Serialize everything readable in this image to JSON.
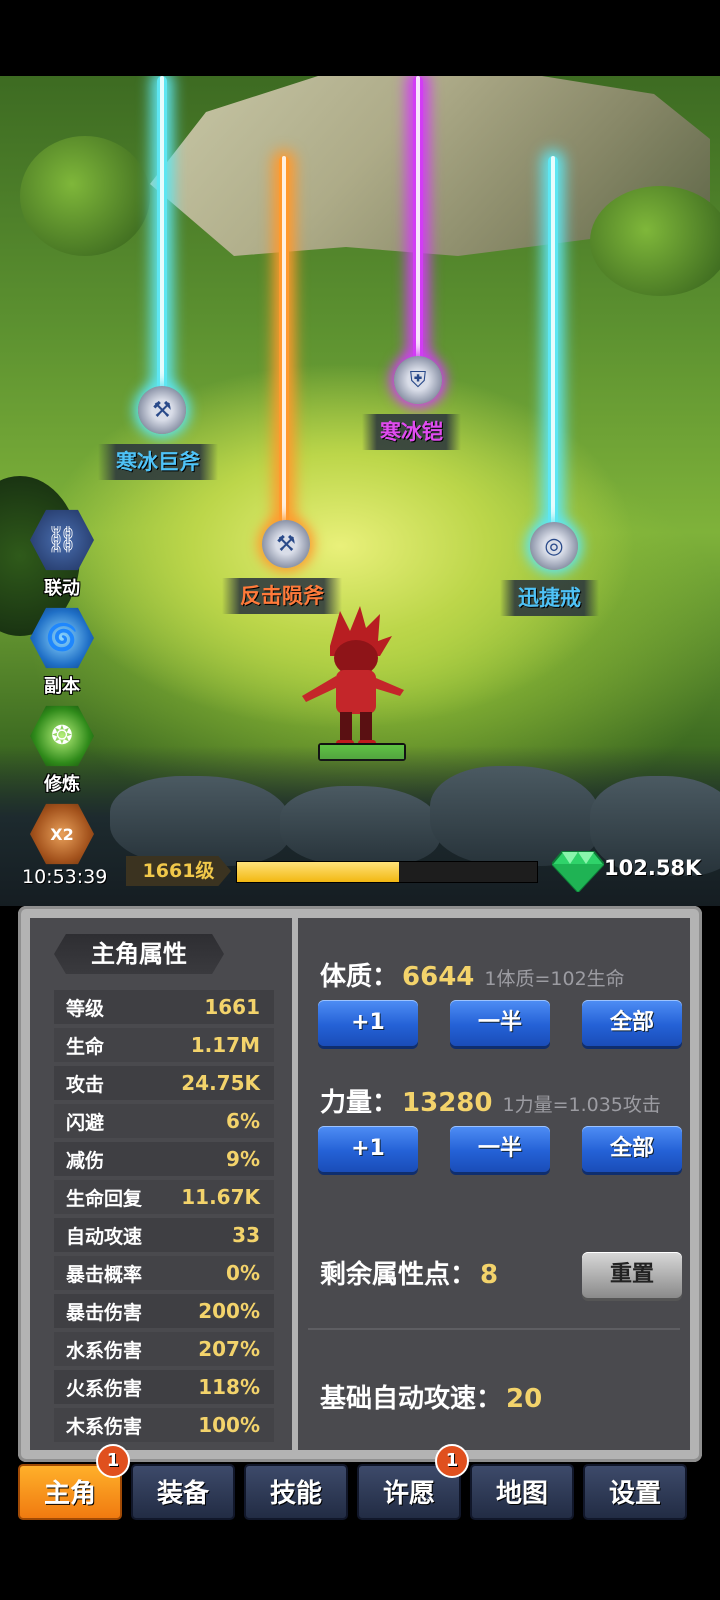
{
  "scene": {
    "drops": [
      {
        "name": "寒冰巨斧",
        "color": "#4fc3f7",
        "beam": "#5ee6f2",
        "icon": "🪓"
      },
      {
        "name": "反击陨斧",
        "color": "#ff7a3a",
        "beam": "#ff9a2e",
        "icon": "🪓"
      },
      {
        "name": "寒冰铠",
        "color": "#e04cf0",
        "beam": "#d23cf5",
        "icon": "🛡"
      },
      {
        "name": "迅捷戒",
        "color": "#4fc3f7",
        "beam": "#5ee6f2",
        "icon": "💍"
      }
    ]
  },
  "side_buttons": [
    {
      "label": "联动",
      "icon": "link-icon"
    },
    {
      "label": "副本",
      "icon": "vortex-icon"
    },
    {
      "label": "修炼",
      "icon": "cultivate-icon"
    },
    {
      "label": "X2",
      "icon": "double-bonus-icon"
    }
  ],
  "timer": "10:53:39",
  "level": {
    "label": "1661级",
    "progress": 0.54
  },
  "gems": "102.58K",
  "hero": {
    "hp_ratio": 1.0
  },
  "stats_panel": {
    "title": "主角属性",
    "rows": [
      {
        "name": "等级",
        "value": "1661"
      },
      {
        "name": "生命",
        "value": "1.17M"
      },
      {
        "name": "攻击",
        "value": "24.75K"
      },
      {
        "name": "闪避",
        "value": "6%"
      },
      {
        "name": "减伤",
        "value": "9%"
      },
      {
        "name": "生命回复",
        "value": "11.67K"
      },
      {
        "name": "自动攻速",
        "value": "33"
      },
      {
        "name": "暴击概率",
        "value": "0%"
      },
      {
        "name": "暴击伤害",
        "value": "200%"
      },
      {
        "name": "水系伤害",
        "value": "207%"
      },
      {
        "name": "火系伤害",
        "value": "118%"
      },
      {
        "name": "木系伤害",
        "value": "100%"
      }
    ]
  },
  "attributes": {
    "constitution": {
      "name": "体质：",
      "value": "6644",
      "note": "1体质=102生命"
    },
    "strength": {
      "name": "力量：",
      "value": "13280",
      "note": "1力量=1.035攻击"
    },
    "buttons": {
      "plus_one": "+1",
      "half": "一半",
      "all": "全部"
    },
    "remaining_label": "剩余属性点：",
    "remaining_value": "8",
    "reset": "重置",
    "base_speed_label": "基础自动攻速：",
    "base_speed_value": "20"
  },
  "tabs": [
    {
      "label": "主角",
      "badge": "1",
      "active": true
    },
    {
      "label": "装备",
      "badge": "",
      "active": false
    },
    {
      "label": "技能",
      "badge": "",
      "active": false
    },
    {
      "label": "许愿",
      "badge": "1",
      "active": false
    },
    {
      "label": "地图",
      "badge": "",
      "active": false
    },
    {
      "label": "设置",
      "badge": "",
      "active": false
    }
  ]
}
